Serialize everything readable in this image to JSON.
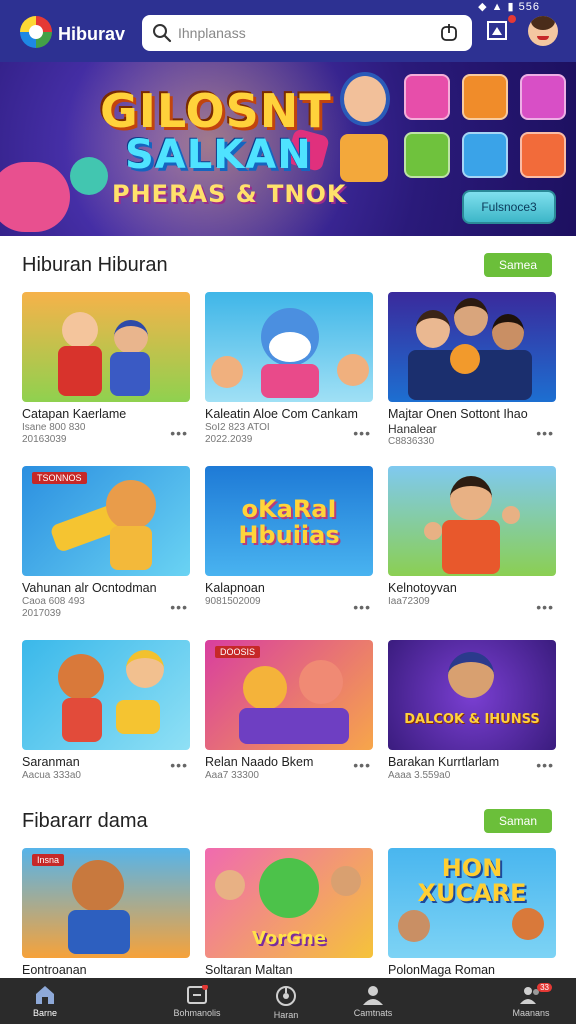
{
  "status": {
    "battery": "556"
  },
  "header": {
    "app_name": "Hiburav",
    "search_placeholder": "Ihnplanass"
  },
  "banner": {
    "line1": "GILOSNT",
    "line2": "SALKAN",
    "line3": "PHERAS & TNOK",
    "button_label": "Fulsnoce3"
  },
  "section1": {
    "title": "Hiburan Hiburan",
    "button_label": "Samea",
    "cards": [
      {
        "title": "Catapan Kaerlame",
        "meta1": "Isane 800 830",
        "meta2": "20163039"
      },
      {
        "title": "Kaleatin Aloe Com Cankam",
        "meta1": "SoI2 823 ATOI",
        "meta2": "2022.2039"
      },
      {
        "title": "Majtar Onen Sottont Ihao",
        "meta1": "Hanalear",
        "meta2": "C8836330"
      },
      {
        "title": "Vahunan alr Ocntodman",
        "meta1": "Caoa 608 493",
        "meta2": "2017039",
        "tag": "TSONNOS"
      },
      {
        "title": "Kalapnoan",
        "meta1": "9081502009",
        "meta2": "",
        "art": "oKaRaI Hbuiias"
      },
      {
        "title": "Kelnotoyvan",
        "meta1": "Iaa72309",
        "meta2": ""
      },
      {
        "title": "Saranman",
        "meta1": "Aacua 333a0",
        "meta2": ""
      },
      {
        "title": "Relan Naado Bkem",
        "meta1": "Aaa7 33300",
        "meta2": "",
        "tag": "DOOSIS"
      },
      {
        "title": "Barakan Kurrtlarlam",
        "meta1": "Aaaa 3.559a0",
        "meta2": "",
        "art": "DALCOK & IHUNSS"
      }
    ]
  },
  "section2": {
    "title": "Fibararr dama",
    "button_label": "Saman",
    "cards": [
      {
        "title": "Eontroanan",
        "tag": "Insna"
      },
      {
        "title": "Soltaran Maltan",
        "art": "VorGne"
      },
      {
        "title": "PolonMaga Roman",
        "art": "HON XUCARE"
      }
    ]
  },
  "bottom_nav": [
    {
      "label": "Barne",
      "icon": "home-icon"
    },
    {
      "label": "Bohmanolis",
      "icon": "library-icon"
    },
    {
      "label": "Haran",
      "icon": "refresh-icon"
    },
    {
      "label": "Camtnats",
      "icon": "profile-icon"
    },
    {
      "label": "Maanans",
      "icon": "friends-icon",
      "badge": "33"
    }
  ],
  "colors": {
    "header": "#2d3192",
    "accent": "#6bbf3a",
    "nav": "#2b2b2b"
  }
}
